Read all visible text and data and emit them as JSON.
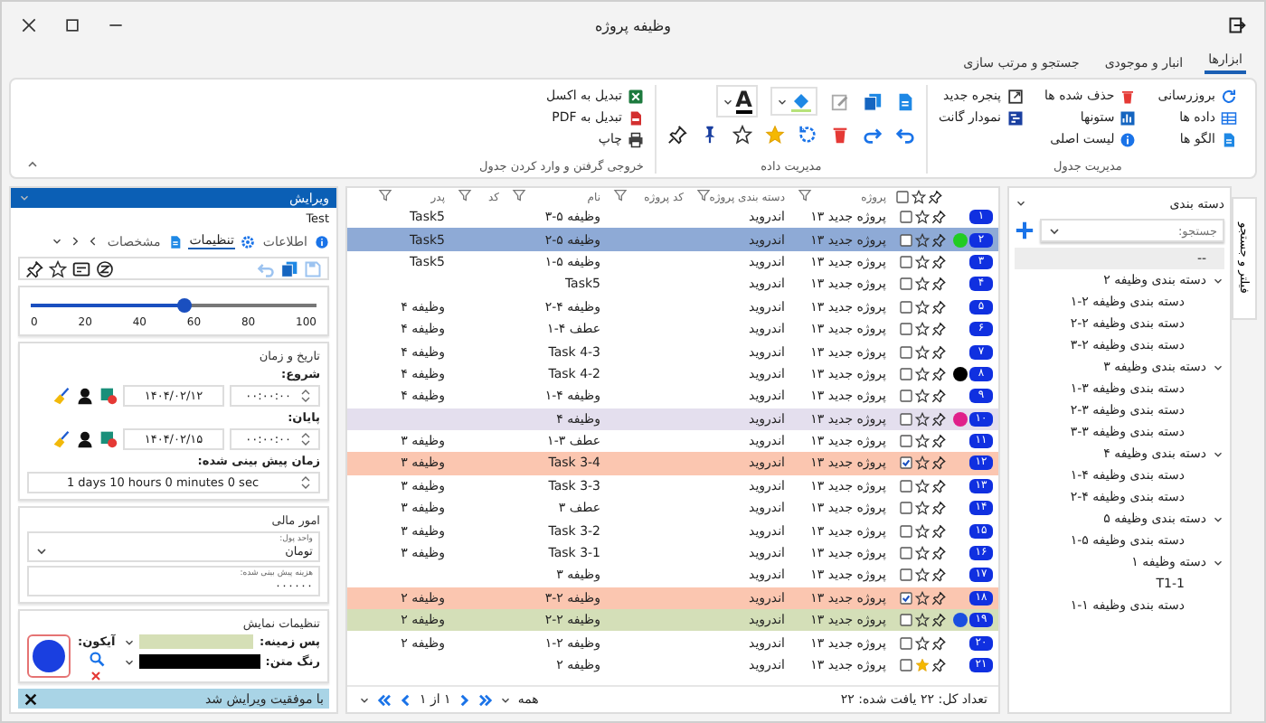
{
  "window": {
    "title": "وظیفه پروژه"
  },
  "ribbon_tabs": [
    {
      "label": "ابزارها",
      "selected": true
    },
    {
      "label": "انبار و موجودی",
      "selected": false
    },
    {
      "label": "جستجو و مرتب سازی",
      "selected": false
    }
  ],
  "ribbon": {
    "table_group": {
      "title": "مدیریت جدول",
      "buttons": [
        "بروزرسانی",
        "داده ها",
        "الگو ها",
        "حذف شده ها",
        "ستونها",
        "لیست اصلی",
        "پنجره جدید",
        "نمودار گانت"
      ]
    },
    "data_group": {
      "title": "مدیریت داده",
      "font_glyph": "A"
    },
    "export_group": {
      "title": "خروجی گرفتن و وارد کردن جدول",
      "buttons": [
        "تبدیل به اکسل",
        "تبدیل به PDF",
        "چاپ"
      ]
    }
  },
  "filter": {
    "tab": "فیلتر و جستجو",
    "title": "دسته بندی",
    "search_placeholder": "جستجو:",
    "tree": [
      {
        "label": "--",
        "selected": true
      },
      {
        "label": "دسته بندی وظیفه ۲",
        "selected": false,
        "expanded": true,
        "children": [
          {
            "label": "دسته بندی وظیفه ۲-۱",
            "selected": false
          },
          {
            "label": "دسته بندی وظیفه ۲-۲",
            "selected": false
          },
          {
            "label": "دسته بندی وظیفه ۲-۳",
            "selected": false
          }
        ]
      },
      {
        "label": "دسته بندی وظیفه ۳",
        "selected": false,
        "expanded": true,
        "children": [
          {
            "label": "دسته بندی وظیفه ۳-۱",
            "selected": false
          },
          {
            "label": "دسته بندی وظیفه ۳-۲",
            "selected": false
          },
          {
            "label": "دسته بندی وظیفه ۳-۳",
            "selected": false
          }
        ]
      },
      {
        "label": "دسته بندی وظیفه ۴",
        "selected": false,
        "expanded": true,
        "children": [
          {
            "label": "دسته بندی وظیفه ۴-۱",
            "selected": false
          },
          {
            "label": "دسته بندی وظیفه ۴-۲",
            "selected": false
          }
        ]
      },
      {
        "label": "دسته بندی وظیفه ۵",
        "selected": false,
        "expanded": true,
        "children": [
          {
            "label": "دسته بندی وظیفه ۵-۱",
            "selected": false
          }
        ]
      },
      {
        "label": "دسته وظیفه ۱",
        "selected": false,
        "expanded": true,
        "children": [
          {
            "label": "T1-1",
            "selected": false
          },
          {
            "label": "دسته بندی وظیفه ۱-۱",
            "selected": false
          }
        ]
      }
    ]
  },
  "table": {
    "all_checked": false,
    "columns": [
      "پروژه",
      "دسته بندی پروژه",
      "کد پروژه",
      "نام",
      "کد",
      "پدر"
    ],
    "rows": [
      {
        "number": "۱",
        "starred": false,
        "checked": false,
        "selected": false,
        "project": "پروژه جدید ۱۳",
        "category": "اندروید",
        "name": "وظیفه ۵-۳",
        "parent": "Task5"
      },
      {
        "number": "۲",
        "starred": false,
        "checked": false,
        "selected": true,
        "project": "پروژه جدید ۱۳",
        "category": "اندروید",
        "name": "وظیفه ۵-۲",
        "parent": "Task5",
        "marker": {
          "color": "#22cc22"
        }
      },
      {
        "number": "۳",
        "starred": false,
        "checked": false,
        "selected": false,
        "project": "پروژه جدید ۱۳",
        "category": "اندروید",
        "name": "وظیفه ۵-۱",
        "parent": "Task5"
      },
      {
        "number": "۴",
        "starred": false,
        "checked": false,
        "selected": false,
        "project": "پروژه جدید ۱۳",
        "category": "اندروید",
        "name": "Task5"
      },
      {
        "number": "۵",
        "starred": false,
        "checked": false,
        "selected": false,
        "project": "پروژه جدید ۱۳",
        "category": "اندروید",
        "name": "وظیفه ۴-۲",
        "parent": "وظیفه ۴"
      },
      {
        "number": "۶",
        "starred": false,
        "checked": false,
        "selected": false,
        "project": "پروژه جدید ۱۳",
        "category": "اندروید",
        "name": "عطف ۴-۱",
        "parent": "وظیفه ۴"
      },
      {
        "number": "۷",
        "starred": false,
        "checked": false,
        "selected": false,
        "project": "پروژه جدید ۱۳",
        "category": "اندروید",
        "name": "Task 4-3",
        "parent": "وظیفه ۴"
      },
      {
        "number": "۸",
        "starred": false,
        "checked": false,
        "selected": false,
        "project": "پروژه جدید ۱۳",
        "category": "اندروید",
        "name": "Task 4-2",
        "parent": "وظیفه ۴",
        "marker": {
          "color": "#000000"
        }
      },
      {
        "number": "۹",
        "starred": false,
        "checked": false,
        "selected": false,
        "project": "پروژه جدید ۱۳",
        "category": "اندروید",
        "name": "وظیفه ۴-۱",
        "parent": "وظیفه ۴"
      },
      {
        "number": "۱۰",
        "starred": false,
        "checked": false,
        "selected": false,
        "project": "پروژه جدید ۱۳",
        "category": "اندروید",
        "name": "وظیفه ۴",
        "color": "#e4dfee",
        "marker": {
          "color": "#e0208a"
        }
      },
      {
        "number": "۱۱",
        "starred": false,
        "checked": false,
        "selected": false,
        "project": "پروژه جدید ۱۳",
        "category": "اندروید",
        "name": "عطف ۳-۱",
        "parent": "وظیفه ۳"
      },
      {
        "number": "۱۲",
        "starred": false,
        "checked": true,
        "selected": false,
        "project": "پروژه جدید ۱۳",
        "category": "اندروید",
        "name": "Task 3-4",
        "parent": "وظیفه ۳",
        "color": "#fbc6b0"
      },
      {
        "number": "۱۳",
        "starred": false,
        "checked": false,
        "selected": false,
        "project": "پروژه جدید ۱۳",
        "category": "اندروید",
        "name": "Task 3-3",
        "parent": "وظیفه ۳"
      },
      {
        "number": "۱۴",
        "starred": false,
        "checked": false,
        "selected": false,
        "project": "پروژه جدید ۱۳",
        "category": "اندروید",
        "name": "عطف ۳",
        "parent": "وظیفه ۳"
      },
      {
        "number": "۱۵",
        "starred": false,
        "checked": false,
        "selected": false,
        "project": "پروژه جدید ۱۳",
        "category": "اندروید",
        "name": "Task 3-2",
        "parent": "وظیفه ۳"
      },
      {
        "number": "۱۶",
        "starred": false,
        "checked": false,
        "selected": false,
        "project": "پروژه جدید ۱۳",
        "category": "اندروید",
        "name": "Task 3-1",
        "parent": "وظیفه ۳"
      },
      {
        "number": "۱۷",
        "starred": false,
        "checked": false,
        "selected": false,
        "project": "پروژه جدید ۱۳",
        "category": "اندروید",
        "name": "وظیفه ۳"
      },
      {
        "number": "۱۸",
        "starred": false,
        "checked": true,
        "selected": false,
        "project": "پروژه جدید ۱۳",
        "category": "اندروید",
        "name": "وظیفه ۲-۳",
        "parent": "وظیفه ۲",
        "color": "#fbc6b0"
      },
      {
        "number": "۱۹",
        "starred": false,
        "checked": false,
        "selected": false,
        "project": "پروژه جدید ۱۳",
        "category": "اندروید",
        "name": "وظیفه ۲-۲",
        "parent": "وظیفه ۲",
        "color": "#d4dfb8",
        "marker": {
          "color": "#1a4fe0"
        }
      },
      {
        "number": "۲۰",
        "starred": false,
        "checked": false,
        "selected": false,
        "project": "پروژه جدید ۱۳",
        "category": "اندروید",
        "name": "وظیفه ۲-۱",
        "parent": "وظیفه ۲"
      },
      {
        "number": "۲۱",
        "starred": true,
        "checked": false,
        "selected": false,
        "project": "پروژه جدید ۱۳",
        "category": "اندروید",
        "name": "وظیفه ۲"
      }
    ],
    "summary": "تعداد کل: ۲۲ یافت شده: ۲۲",
    "page_size": "همه",
    "page": "۱ از ۱"
  },
  "editor": {
    "title": "ویرایش",
    "record": "Test",
    "tabs": [
      {
        "label": "اطلاعات",
        "selected": false
      },
      {
        "label": "تنظیمات",
        "selected": true
      },
      {
        "label": "مشخصات",
        "selected": false
      }
    ],
    "slider": {
      "level": 0.54,
      "ticks": [
        "100",
        "80",
        "60",
        "40",
        "20",
        "0"
      ]
    },
    "datetime": {
      "title": "تاریخ و زمان",
      "start": {
        "label": "شروع:",
        "date": "۱۴۰۴/۰۲/۱۲",
        "time": "۰۰:۰۰:۰۰"
      },
      "end": {
        "label": "پایان:",
        "date": "۱۴۰۴/۰۲/۱۵",
        "time": "۰۰:۰۰:۰۰"
      },
      "duration_label": "زمان پیش بینی شده:",
      "duration": "1 days 10 hours 0 minutes 0 sec"
    },
    "finance": {
      "title": "امور مالی",
      "currency_label": "واحد پول:",
      "currency": "تومان",
      "cost_label": "هزینه پیش بینی شده:",
      "cost": "۰۰۰۰۰۰"
    },
    "display": {
      "title": "تنظیمات نمایش",
      "swatches": [
        {
          "label": "پس زمینه:",
          "color": "#d5dfb6"
        },
        {
          "label": "رنگ متن:",
          "color": "#000000"
        }
      ],
      "icon_label": "آیکون:"
    },
    "status": "با موفقیت ویرایش شد"
  }
}
